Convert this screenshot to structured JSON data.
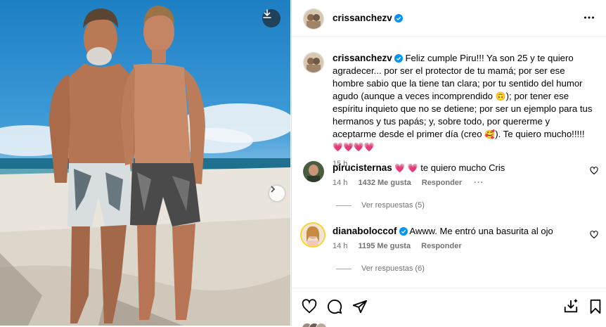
{
  "post": {
    "username": "crissanchezv",
    "more_icon": "more-horizontal-icon",
    "caption": {
      "username": "crissanchezv",
      "text_1": "Feliz cumple Piru!!! Ya son 25 y te quiero agradecer... por ser el protector de tu mamá; por ser ese hombre sabio que la tiene tan clara; por tu sentido del humor agudo (aunque a veces incomprendido",
      "emoji_1": "🙃",
      "text_2": "); por tener ese espíritu inquieto que no se detiene; por ser un ejemplo para tus hermanos y tus papás; y, sobre todo, por quererme y aceptarme desde el primer día (creo",
      "emoji_2": "🥰",
      "text_3": "). Te quiero mucho!!!!!",
      "hearts": "💗💗💗💗",
      "time": "15 h"
    }
  },
  "comments": [
    {
      "username": "pirucisternas",
      "hearts": "💗 💗",
      "text": "te quiero mucho Cris",
      "time": "14 h",
      "likes": "1432 Me gusta",
      "reply": "Responder",
      "more": "···",
      "view_replies": "Ver respuestas (5)"
    },
    {
      "username": "dianaboloccof",
      "text": "Awww. Me entró una basurita al ojo",
      "time": "14 h",
      "likes": "1195 Me gusta",
      "reply": "Responder",
      "view_replies": "Ver respuestas (6)"
    }
  ],
  "colors": {
    "verified": "#0095f6",
    "meta_gray": "#737373",
    "divider": "#dbdbdb"
  }
}
